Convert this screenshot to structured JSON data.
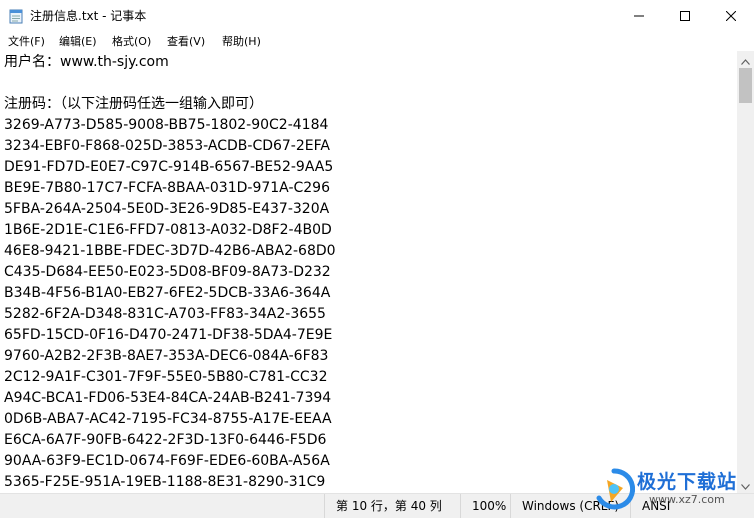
{
  "window": {
    "title": "注册信息.txt - 记事本"
  },
  "menu": {
    "items": [
      "文件(F)",
      "编辑(E)",
      "格式(O)",
      "查看(V)",
      "帮助(H)"
    ]
  },
  "editor": {
    "lines": [
      "用户名：www.th-sjy.com",
      "",
      "注册码：（以下注册码任选一组输入即可）",
      "3269-A773-D585-9008-BB75-1802-90C2-4184",
      "3234-EBF0-F868-025D-3853-ACDB-CD67-2EFA",
      "DE91-FD7D-E0E7-C97C-914B-6567-BE52-9AA5",
      "BE9E-7B80-17C7-FCFA-8BAA-031D-971A-C296",
      "5FBA-264A-2504-5E0D-3E26-9D85-E437-320A",
      "1B6E-2D1E-C1E6-FFD7-0813-A032-D8F2-4B0D",
      "46E8-9421-1BBE-FDEC-3D7D-42B6-ABA2-68D0",
      "C435-D684-EE50-E023-5D08-BF09-8A73-D232",
      "B34B-4F56-B1A0-EB27-6FE2-5DCB-33A6-364A",
      "5282-6F2A-D348-831C-A703-FF83-34A2-3655",
      "65FD-15CD-0F16-D470-2471-DF38-5DA4-7E9E",
      "9760-A2B2-2F3B-8AE7-353A-DEC6-084A-6F83",
      "2C12-9A1F-C301-7F9F-55E0-5B80-C781-CC32",
      "A94C-BCA1-FD06-53E4-84CA-24AB-B241-7394",
      "0D6B-ABA7-AC42-7195-FC34-8755-A17E-EEAA",
      "E6CA-6A7F-90FB-6422-2F3D-13F0-6446-F5D6",
      "90AA-63F9-EC1D-0674-F69F-EDE6-60BA-A56A",
      "5365-F25E-951A-19EB-1188-8E31-8290-31C9"
    ]
  },
  "status": {
    "position": "第 10 行，第 40 列",
    "zoom": "100%",
    "line_ending": "Windows (CRLF)",
    "encoding": "ANSI"
  },
  "watermark": {
    "title": "极光下载站",
    "url": "www.xz7.com"
  },
  "icons": {
    "app": "notepad-icon",
    "minimize": "minimize-icon",
    "maximize": "maximize-icon",
    "close": "close-icon"
  }
}
